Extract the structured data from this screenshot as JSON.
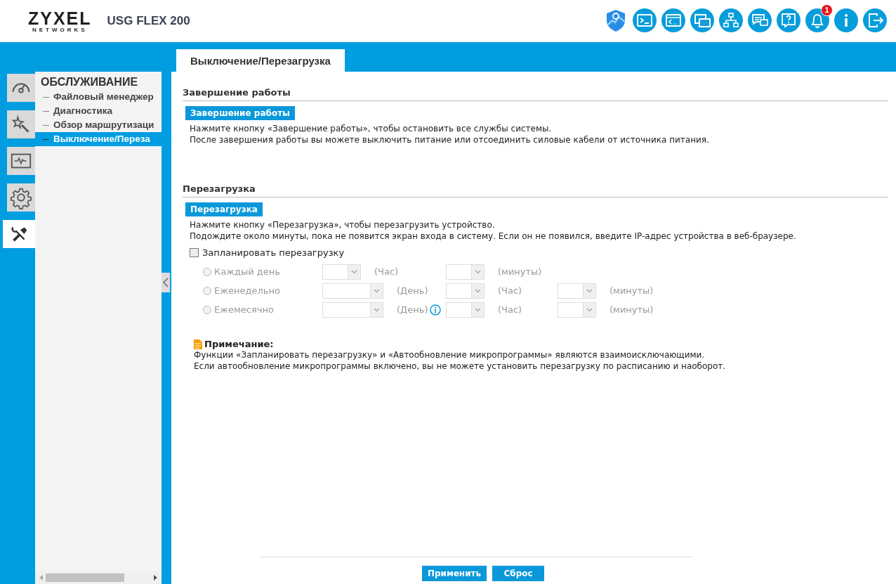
{
  "header": {
    "logo": "ZYXEL",
    "logo_sub": "NETWORKS",
    "model": "USG FLEX 200",
    "toolbar": [
      {
        "kind": "shield"
      },
      {
        "kind": "console"
      },
      {
        "kind": "cli"
      },
      {
        "kind": "windows"
      },
      {
        "kind": "tree"
      },
      {
        "kind": "chat"
      },
      {
        "kind": "help"
      },
      {
        "kind": "bell",
        "badge": "1"
      },
      {
        "kind": "info"
      },
      {
        "kind": "logout"
      }
    ]
  },
  "nav_tabs": [
    {
      "kind": "dashboard",
      "selected": false
    },
    {
      "kind": "wizard",
      "selected": false
    },
    {
      "kind": "monitor",
      "selected": false
    },
    {
      "kind": "config",
      "selected": false
    },
    {
      "kind": "maintenance",
      "selected": true
    }
  ],
  "menu": {
    "title": "ОБСЛУЖИВАНИЕ",
    "items": [
      {
        "label": "Файловый менеджер",
        "selected": false
      },
      {
        "label": "Диагностика",
        "selected": false
      },
      {
        "label": "Обзор маршрутизаци",
        "selected": false
      },
      {
        "label": "Выключение/Переза",
        "selected": true
      }
    ]
  },
  "page_tab": "Выключение/Перезагрузка",
  "sections": [
    {
      "title": "Завершение работы",
      "button": "Завершение работы",
      "lines": [
        "Нажмите кнопку «Завершение работы», чтобы остановить все службы системы.",
        "После завершения работы вы можете выключить питание или отсоединить силовые кабели от источника питания."
      ]
    },
    {
      "title": "Перезагрузка",
      "button": "Перезагрузка",
      "lines": [
        "Нажмите кнопку «Перезагрузка», чтобы перезагрузить устройство.",
        "Подождите около минуты, пока не появится экран входа в систему. Если он не появился, введите IP-адрес устройства в веб-браузере."
      ]
    }
  ],
  "schedule": {
    "label": "Запланировать перезагрузку",
    "checked": false,
    "options": [
      {
        "label": "Каждый день",
        "selected": false,
        "disabled": true,
        "fields": [
          {
            "unit": "(Час)",
            "info_icon": false
          },
          {
            "unit": "(минуты)",
            "info_icon": false
          }
        ]
      },
      {
        "label": "Еженедельно",
        "selected": false,
        "disabled": true,
        "fields": [
          {
            "unit": "(День)",
            "info_icon": false
          },
          {
            "unit": "(Час)",
            "info_icon": false
          },
          {
            "unit": "(минуты)",
            "info_icon": false
          }
        ]
      },
      {
        "label": "Ежемесячно",
        "selected": false,
        "disabled": true,
        "fields": [
          {
            "unit": "(День)",
            "info_icon": true
          },
          {
            "unit": "(Час)",
            "info_icon": false
          },
          {
            "unit": "(минуты)",
            "info_icon": false
          }
        ]
      }
    ]
  },
  "note": {
    "title": "Примечание:",
    "lines": [
      "Функции «Запланировать перезагрузку» и «Автообновление микропрограммы» являются взаимоисключающими.",
      "Если автообновление микропрограммы включено, вы не можете установить перезагрузку по расписанию и наоборот."
    ]
  },
  "buttons": [
    "Применить",
    "Сброс"
  ]
}
